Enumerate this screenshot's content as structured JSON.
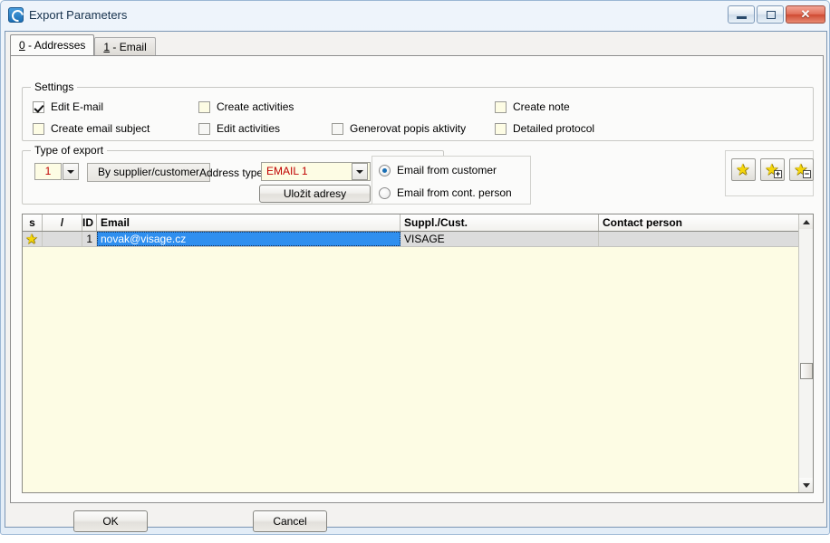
{
  "window": {
    "title": "Export Parameters",
    "icon": "app-swirl-icon",
    "minimize_label": "",
    "maximize_label": "",
    "close_label": "✕"
  },
  "tabs": [
    {
      "accel": "0",
      "label": " - Addresses",
      "active": true
    },
    {
      "accel": "1",
      "label": " - Email",
      "active": false
    }
  ],
  "settings": {
    "title": "Settings",
    "checkboxes": [
      {
        "label": "Edit E-mail",
        "checked": true,
        "style": "checked"
      },
      {
        "label": "Create email subject",
        "checked": false,
        "style": "cream"
      },
      {
        "label": "Create activities",
        "checked": false,
        "style": "cream"
      },
      {
        "label": "Edit activities",
        "checked": false,
        "style": "plain"
      },
      {
        "label": "Generovat popis aktivity",
        "checked": false,
        "style": "plain"
      },
      {
        "label": "Create note",
        "checked": false,
        "style": "cream"
      },
      {
        "label": "Detailed protocol",
        "checked": false,
        "style": "cream"
      }
    ]
  },
  "type_of_export": {
    "title": "Type of export",
    "number_value": "1",
    "mode_value": "By supplier/customer",
    "address_type_label": "Address type",
    "address_type_value": "EMAIL 1",
    "save_addresses_button": "Uložit adresy"
  },
  "email_source": {
    "options": [
      {
        "label": "Email from customer",
        "selected": true
      },
      {
        "label": "Email from cont. person",
        "selected": false
      }
    ]
  },
  "star_toolbar": {
    "buttons": [
      {
        "icon": "star-icon",
        "badge": ""
      },
      {
        "icon": "star-plus-icon",
        "badge": "+"
      },
      {
        "icon": "star-minus-icon",
        "badge": "−"
      }
    ]
  },
  "grid": {
    "columns": [
      {
        "key": "s",
        "label": "s",
        "align": "center"
      },
      {
        "key": "slash",
        "label": "/",
        "align": "center"
      },
      {
        "key": "id",
        "label": "ID",
        "align": "right"
      },
      {
        "key": "email",
        "label": "Email",
        "align": "left"
      },
      {
        "key": "suppl",
        "label": "Suppl./Cust.",
        "align": "left"
      },
      {
        "key": "contact",
        "label": "Contact person",
        "align": "left"
      }
    ],
    "rows": [
      {
        "s": "star-icon",
        "slash": "",
        "id": "1",
        "email": "novak@visage.cz",
        "suppl": "VISAGE",
        "contact": "",
        "selected_cell": "email"
      }
    ]
  },
  "footer": {
    "ok_label": "OK",
    "cancel_label": "Cancel"
  },
  "colors": {
    "accent_blue": "#2f8fef",
    "field_cream": "#fdfce4",
    "field_red_text": "#c00000",
    "star_yellow": "#f5d60a",
    "grid_background": "#fdfce4",
    "row_gray": "#dcdcdc"
  }
}
